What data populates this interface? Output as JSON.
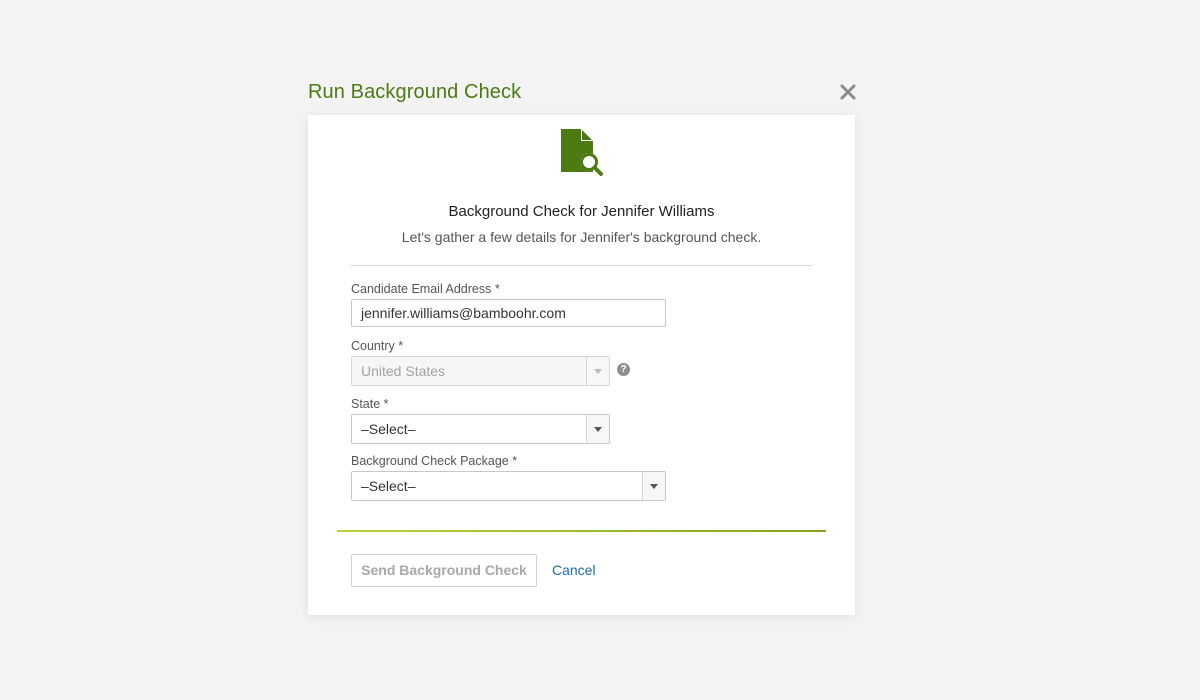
{
  "dialog": {
    "title": "Run Background Check",
    "close_icon": "close-icon"
  },
  "header": {
    "icon": "document-search-icon",
    "heading": "Background Check for Jennifer Williams",
    "subheading": "Let's gather a few details for Jennifer's background check."
  },
  "form": {
    "email": {
      "label": "Candidate Email Address *",
      "value": "jennifer.williams@bamboohr.com"
    },
    "country": {
      "label": "Country *",
      "value": "United States",
      "disabled": true,
      "help_icon": "question-icon",
      "help_glyph": "?"
    },
    "state": {
      "label": "State *",
      "value": "–Select–"
    },
    "package": {
      "label": "Background Check Package *",
      "value": "–Select–"
    }
  },
  "actions": {
    "send_label": "Send Background Check",
    "cancel_label": "Cancel"
  },
  "colors": {
    "brand_green": "#4c7a13",
    "link_blue": "#1e6aa8",
    "page_bg": "#f3f3f3"
  }
}
